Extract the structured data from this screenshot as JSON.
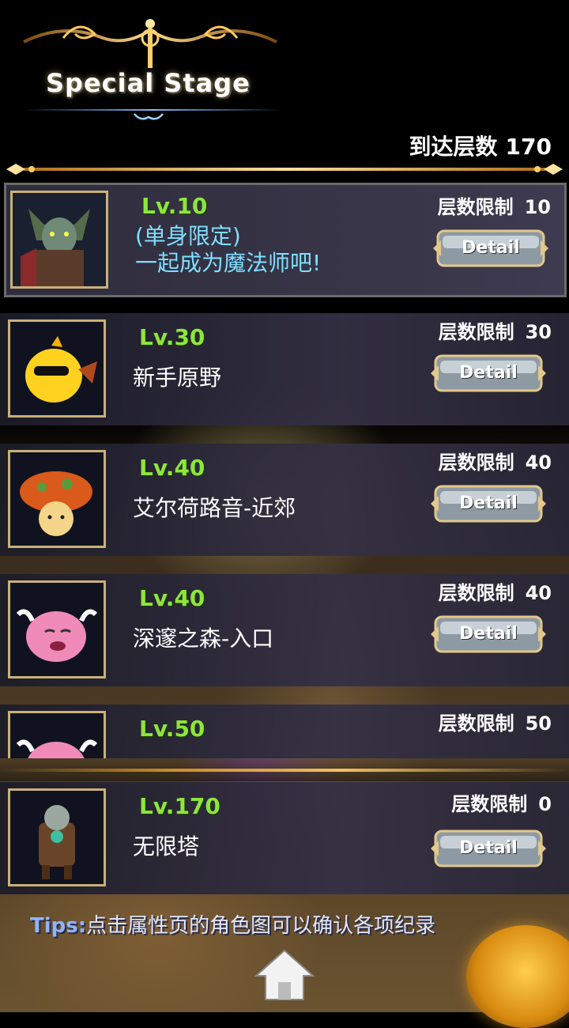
{
  "header": {
    "title": "Special Stage",
    "reach_label": "到达层数",
    "reach_value": "170"
  },
  "stages": [
    {
      "level": "Lv.10",
      "name_line1": "(单身限定)",
      "name_line2": "一起成为魔法师吧!",
      "limit_label": "层数限制",
      "limit_value": "10",
      "detail": "Detail"
    },
    {
      "level": "Lv.30",
      "name": "新手原野",
      "limit_label": "层数限制",
      "limit_value": "30",
      "detail": "Detail"
    },
    {
      "level": "Lv.40",
      "name": "艾尔荷路音-近郊",
      "limit_label": "层数限制",
      "limit_value": "40",
      "detail": "Detail"
    },
    {
      "level": "Lv.40",
      "name": "深邃之森-入口",
      "limit_label": "层数限制",
      "limit_value": "40",
      "detail": "Detail"
    },
    {
      "level": "Lv.50",
      "limit_label": "层数限制",
      "limit_value": "50"
    }
  ],
  "infinite": {
    "level": "Lv.170",
    "name": "无限塔",
    "limit_label": "层数限制",
    "limit_value": "0",
    "detail": "Detail"
  },
  "tips": {
    "prefix": "Tips:",
    "text": "点击属性页的角色图可以确认各项纪录"
  },
  "colors": {
    "level_green": "#8ee63a",
    "gold": "#e8b860",
    "cyan_name": "#7fdfff"
  }
}
